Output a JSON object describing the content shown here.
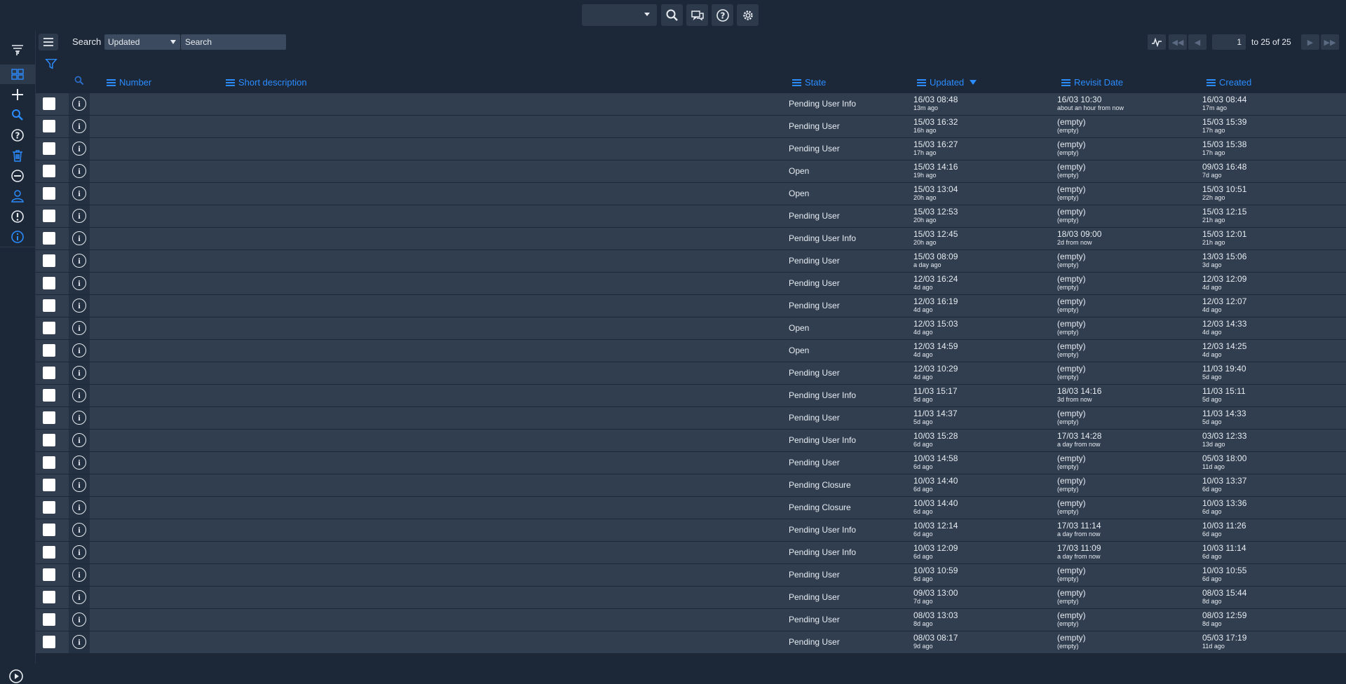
{
  "topbar": {
    "icons": [
      "search-icon",
      "chat-icon",
      "help-icon",
      "gear-icon"
    ]
  },
  "search": {
    "label": "Search",
    "field_value": "Updated",
    "placeholder": "Search"
  },
  "pagination": {
    "page_value": "1",
    "range_text": "to 25 of 25"
  },
  "columns": {
    "number": "Number",
    "short_description": "Short description",
    "state": "State",
    "updated": "Updated",
    "revisit": "Revisit Date",
    "created": "Created"
  },
  "rows": [
    {
      "state": "Pending User Info",
      "updated": "16/03 08:48",
      "updated_rel": "13m ago",
      "revisit": "16/03 10:30",
      "revisit_rel": "about an hour from now",
      "created": "16/03 08:44",
      "created_rel": "17m ago"
    },
    {
      "state": "Pending User",
      "updated": "15/03 16:32",
      "updated_rel": "16h ago",
      "revisit": "(empty)",
      "revisit_rel": "(empty)",
      "created": "15/03 15:39",
      "created_rel": "17h ago"
    },
    {
      "state": "Pending User",
      "updated": "15/03 16:27",
      "updated_rel": "17h ago",
      "revisit": "(empty)",
      "revisit_rel": "(empty)",
      "created": "15/03 15:38",
      "created_rel": "17h ago"
    },
    {
      "state": "Open",
      "updated": "15/03 14:16",
      "updated_rel": "19h ago",
      "revisit": "(empty)",
      "revisit_rel": "(empty)",
      "created": "09/03 16:48",
      "created_rel": "7d ago"
    },
    {
      "state": "Open",
      "updated": "15/03 13:04",
      "updated_rel": "20h ago",
      "revisit": "(empty)",
      "revisit_rel": "(empty)",
      "created": "15/03 10:51",
      "created_rel": "22h ago"
    },
    {
      "state": "Pending User",
      "updated": "15/03 12:53",
      "updated_rel": "20h ago",
      "revisit": "(empty)",
      "revisit_rel": "(empty)",
      "created": "15/03 12:15",
      "created_rel": "21h ago"
    },
    {
      "state": "Pending User Info",
      "updated": "15/03 12:45",
      "updated_rel": "20h ago",
      "revisit": "18/03 09:00",
      "revisit_rel": "2d from now",
      "created": "15/03 12:01",
      "created_rel": "21h ago"
    },
    {
      "state": "Pending User",
      "updated": "15/03 08:09",
      "updated_rel": "a day ago",
      "revisit": "(empty)",
      "revisit_rel": "(empty)",
      "created": "13/03 15:06",
      "created_rel": "3d ago"
    },
    {
      "state": "Pending User",
      "updated": "12/03 16:24",
      "updated_rel": "4d ago",
      "revisit": "(empty)",
      "revisit_rel": "(empty)",
      "created": "12/03 12:09",
      "created_rel": "4d ago"
    },
    {
      "state": "Pending User",
      "updated": "12/03 16:19",
      "updated_rel": "4d ago",
      "revisit": "(empty)",
      "revisit_rel": "(empty)",
      "created": "12/03 12:07",
      "created_rel": "4d ago"
    },
    {
      "state": "Open",
      "updated": "12/03 15:03",
      "updated_rel": "4d ago",
      "revisit": "(empty)",
      "revisit_rel": "(empty)",
      "created": "12/03 14:33",
      "created_rel": "4d ago"
    },
    {
      "state": "Open",
      "updated": "12/03 14:59",
      "updated_rel": "4d ago",
      "revisit": "(empty)",
      "revisit_rel": "(empty)",
      "created": "12/03 14:25",
      "created_rel": "4d ago"
    },
    {
      "state": "Pending User",
      "updated": "12/03 10:29",
      "updated_rel": "4d ago",
      "revisit": "(empty)",
      "revisit_rel": "(empty)",
      "created": "11/03 19:40",
      "created_rel": "5d ago"
    },
    {
      "state": "Pending User Info",
      "updated": "11/03 15:17",
      "updated_rel": "5d ago",
      "revisit": "18/03 14:16",
      "revisit_rel": "3d from now",
      "created": "11/03 15:11",
      "created_rel": "5d ago"
    },
    {
      "state": "Pending User",
      "updated": "11/03 14:37",
      "updated_rel": "5d ago",
      "revisit": "(empty)",
      "revisit_rel": "(empty)",
      "created": "11/03 14:33",
      "created_rel": "5d ago"
    },
    {
      "state": "Pending User Info",
      "updated": "10/03 15:28",
      "updated_rel": "6d ago",
      "revisit": "17/03 14:28",
      "revisit_rel": "a day from now",
      "created": "03/03 12:33",
      "created_rel": "13d ago"
    },
    {
      "state": "Pending User",
      "updated": "10/03 14:58",
      "updated_rel": "6d ago",
      "revisit": "(empty)",
      "revisit_rel": "(empty)",
      "created": "05/03 18:00",
      "created_rel": "11d ago"
    },
    {
      "state": "Pending Closure",
      "updated": "10/03 14:40",
      "updated_rel": "6d ago",
      "revisit": "(empty)",
      "revisit_rel": "(empty)",
      "created": "10/03 13:37",
      "created_rel": "6d ago"
    },
    {
      "state": "Pending Closure",
      "updated": "10/03 14:40",
      "updated_rel": "6d ago",
      "revisit": "(empty)",
      "revisit_rel": "(empty)",
      "created": "10/03 13:36",
      "created_rel": "6d ago"
    },
    {
      "state": "Pending User Info",
      "updated": "10/03 12:14",
      "updated_rel": "6d ago",
      "revisit": "17/03 11:14",
      "revisit_rel": "a day from now",
      "created": "10/03 11:26",
      "created_rel": "6d ago"
    },
    {
      "state": "Pending User Info",
      "updated": "10/03 12:09",
      "updated_rel": "6d ago",
      "revisit": "17/03 11:09",
      "revisit_rel": "a day from now",
      "created": "10/03 11:14",
      "created_rel": "6d ago"
    },
    {
      "state": "Pending User",
      "updated": "10/03 10:59",
      "updated_rel": "6d ago",
      "revisit": "(empty)",
      "revisit_rel": "(empty)",
      "created": "10/03 10:55",
      "created_rel": "6d ago"
    },
    {
      "state": "Pending User",
      "updated": "09/03 13:00",
      "updated_rel": "7d ago",
      "revisit": "(empty)",
      "revisit_rel": "(empty)",
      "created": "08/03 15:44",
      "created_rel": "8d ago"
    },
    {
      "state": "Pending User",
      "updated": "08/03 13:03",
      "updated_rel": "8d ago",
      "revisit": "(empty)",
      "revisit_rel": "(empty)",
      "created": "08/03 12:59",
      "created_rel": "8d ago"
    },
    {
      "state": "Pending User",
      "updated": "08/03 08:17",
      "updated_rel": "9d ago",
      "revisit": "(empty)",
      "revisit_rel": "(empty)",
      "created": "05/03 17:19",
      "created_rel": "11d ago"
    }
  ],
  "colors": {
    "accent": "#2b8cff",
    "background": "#1c2838",
    "row": "#303e50"
  }
}
